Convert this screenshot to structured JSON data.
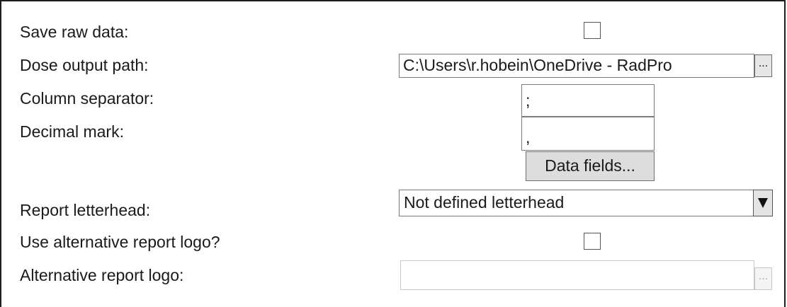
{
  "labels": {
    "save_raw_data": "Save raw data:",
    "dose_output_path": "Dose output path:",
    "column_separator": "Column separator:",
    "decimal_mark": "Decimal mark:",
    "report_letterhead": "Report letterhead:",
    "use_alternative_logo": "Use alternative report logo?",
    "alternative_logo": "Alternative report logo:"
  },
  "fields": {
    "save_raw_data_checked": false,
    "dose_output_path_value": "C:\\Users\\r.hobein\\OneDrive - RadPro",
    "dose_output_browse": "...",
    "column_separator_value": ";",
    "decimal_mark_value": ",",
    "data_fields_button": "Data fields...",
    "report_letterhead_value": "Not defined letterhead",
    "use_alternative_logo_checked": false,
    "alternative_logo_value": "",
    "alternative_logo_browse": "..."
  },
  "icons": {
    "combo_arrow": "triangle-down-icon"
  }
}
